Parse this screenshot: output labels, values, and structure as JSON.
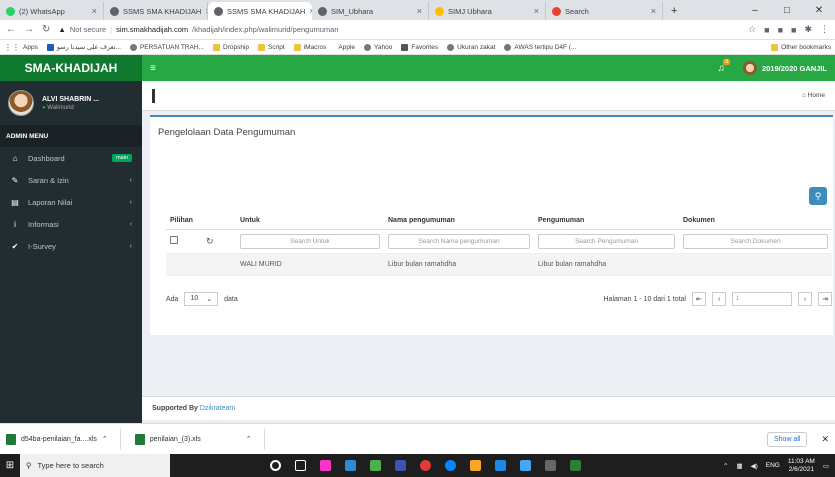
{
  "browser": {
    "tabs": [
      {
        "label": "(2) WhatsApp",
        "color": "#25d366"
      },
      {
        "label": "SSMS SMA KHADIJAH",
        "color": "#5f6368"
      },
      {
        "label": "SSMS SMA KHADIJAH",
        "color": "#5f6368",
        "active": true
      },
      {
        "label": "SIM_Ubhara",
        "color": "#5f6368"
      },
      {
        "label": "SIMJ Ubhara",
        "color": "#fbbc05"
      },
      {
        "label": "Search",
        "color": "#ea4335"
      }
    ],
    "new_tab": "+",
    "address": {
      "not_secure": "Not secure",
      "host": "sim.smakhadijah.com",
      "path": "/khadijah/index.php/walimurid/pengumuman"
    },
    "bookmarks": [
      "Apps",
      "تعرف على سيدنا رسو...",
      "PERSATUAN TRAH...",
      "Dropship",
      "Script",
      "iMacros",
      "Apple",
      "Yahoo",
      "Favorites",
      "Ukuran zakat",
      "AWAS tertipu D4F (..."
    ],
    "other_bookmarks": "Other bookmarks"
  },
  "app": {
    "brand": "SMA-KHADIJAH",
    "user": {
      "name": "ALVI SHABRIN ...",
      "role": "Walimurid"
    },
    "menu_header": "ADMIN MENU",
    "menu": [
      {
        "label": "Dashboard",
        "icon": "dashboard-icon",
        "glyph": "⌂",
        "badge": "main"
      },
      {
        "label": "Saran & Izin",
        "icon": "pencil-icon",
        "glyph": "✎"
      },
      {
        "label": "Laporan Nilai",
        "icon": "book-icon",
        "glyph": "▤"
      },
      {
        "label": "Informasi",
        "icon": "info-icon",
        "glyph": "i"
      },
      {
        "label": "I-Survey",
        "icon": "check-icon",
        "glyph": "✔"
      }
    ],
    "topbar": {
      "notif_count": "0",
      "period": "2019/2020 GANJIL"
    },
    "breadcrumb": "Home",
    "box_title": "Pengelolaan Data Pengumuman",
    "table": {
      "headers": [
        "Pilihan",
        "Untuk",
        "Nama pengumuman",
        "Pengumuman",
        "Dokumen"
      ],
      "filters": [
        "Search Untuk",
        "Search Nama pengumuman",
        "Search Pengumuman",
        "Search Dokumen"
      ],
      "rows": [
        {
          "untuk": "WALI MURID",
          "nama": "Libur bulan ramahdha",
          "pengumuman": "Libur bulan ramahdha",
          "dokumen": ""
        }
      ]
    },
    "pager": {
      "show_label": "Ada",
      "page_size": "10",
      "data_label": "data",
      "info": "Halaman 1 - 10 dari 1 total",
      "page": "1"
    },
    "footer": {
      "prefix": "Supported By",
      "name": "Dzikrateam"
    }
  },
  "downloads": {
    "items": [
      "d54ba-penilaian_fa....xls",
      "penilaian_(3).xls"
    ],
    "show_all": "Show all"
  },
  "taskbar": {
    "search_placeholder": "Type here to search",
    "lang": "ENG",
    "time": "11:03 AM",
    "date": "2/6/2021"
  }
}
